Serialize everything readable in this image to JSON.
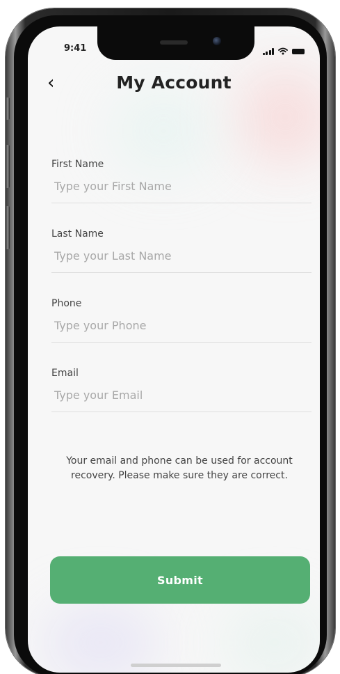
{
  "status_bar": {
    "time": "9:41",
    "icons": [
      "signal-icon",
      "wifi-icon",
      "battery-icon"
    ]
  },
  "header": {
    "back_icon": "chevron-left-icon",
    "back_glyph": "‹",
    "title": "My Account"
  },
  "form": {
    "fields": [
      {
        "label": "First Name",
        "placeholder": "Type your First Name",
        "value": ""
      },
      {
        "label": "Last Name",
        "placeholder": "Type your Last Name",
        "value": ""
      },
      {
        "label": "Phone",
        "placeholder": "Type your Phone",
        "value": ""
      },
      {
        "label": "Email",
        "placeholder": "Type your Email",
        "value": ""
      }
    ]
  },
  "notice": "Your email and phone can be used for account recovery. Please make sure they are correct.",
  "submit": {
    "label": "Submit",
    "color": "#55af73"
  },
  "colors": {
    "accent": "#55af73",
    "screen_background": "#f7f7f7",
    "frame": "#1a1a1a"
  }
}
